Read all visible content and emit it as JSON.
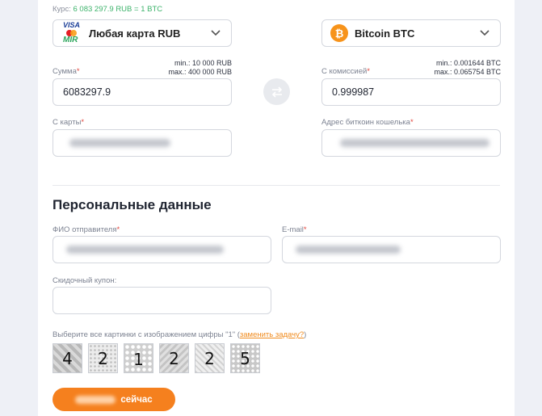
{
  "exchange": {
    "rate_label": "Курс:",
    "rate_value": "6 083 297.9 RUB = 1 BTC",
    "from": {
      "currency": "Любая карта RUB",
      "icon": "card-systems-icon",
      "amount_label": "Сумма",
      "min": "min.: 10 000 RUB",
      "max": "max.: 400 000 RUB",
      "amount_value": "6083297.9",
      "card_label": "С карты"
    },
    "to": {
      "currency": "Bitcoin BTC",
      "icon": "bitcoin-icon",
      "amount_label": "С комиссией",
      "min": "min.: 0.001644 BTC",
      "max": "max.: 0.065754 BTC",
      "amount_value": "0.999987",
      "wallet_label": "Адрес биткоин кошелька"
    },
    "swap_icon": "swap-arrows-icon"
  },
  "personal": {
    "title": "Персональные данные",
    "name_label": "ФИО отправителя",
    "email_label": "E-mail",
    "coupon_label": "Скидочный купон:"
  },
  "captcha": {
    "prompt": "Выберите все картинки с изображением цифры \"1\" (",
    "change_link": "заменить задачу?",
    "prompt_end": ")",
    "tiles": [
      "4",
      "2",
      "1",
      "2",
      "2",
      "5"
    ]
  },
  "submit": {
    "label_suffix": "сейчас"
  },
  "required_mark": "*",
  "colors": {
    "accent": "#f5801e",
    "rate_green": "#3db36b",
    "required_red": "#e3463d",
    "bitcoin_orange": "#f7931a"
  }
}
